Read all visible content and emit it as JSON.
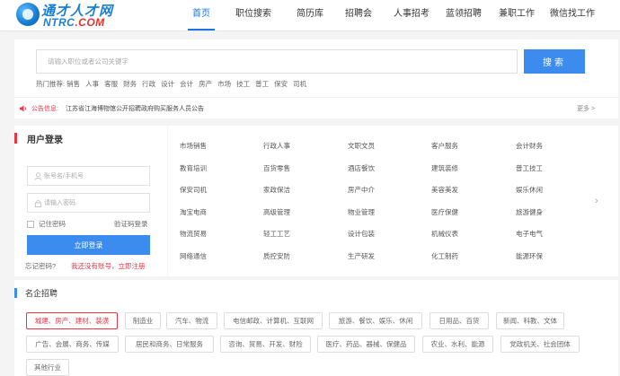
{
  "logo": {
    "cn": "通才人才网",
    "en_prefix": "NTRC",
    "en_suffix": ".COM"
  },
  "nav": [
    {
      "label": "首页",
      "active": true
    },
    {
      "label": "职位搜索"
    },
    {
      "label": "简历库"
    },
    {
      "label": "招聘会"
    },
    {
      "label": "人事招考"
    },
    {
      "label": "蓝领招聘"
    },
    {
      "label": "兼职工作"
    },
    {
      "label": "微信找工作"
    }
  ],
  "search": {
    "placeholder": "请输入职位或者公司关键字",
    "button": "搜索",
    "hot_label": "热门推荐:",
    "hot_keywords": [
      "销售",
      "人事",
      "客服",
      "财务",
      "行政",
      "设计",
      "会计",
      "房产",
      "市场",
      "技工",
      "普工",
      "保安",
      "司机"
    ]
  },
  "notice": {
    "label": "公告信息:",
    "text": "江苏省江海博物馆公开招聘政府购买服务人员公告",
    "more": "更多 >"
  },
  "login": {
    "title": "用户登录",
    "account_placeholder": "账号名/手机号",
    "password_placeholder": "请输入密码",
    "remember": "记住密码",
    "code_login": "验证码登录",
    "submit": "立即登录",
    "forgot": "忘记密码?",
    "register": "我还没有账号，立即注册"
  },
  "categories": [
    [
      "市场销售",
      "行政人事",
      "文职文员",
      "客户服务",
      "会计财务"
    ],
    [
      "教育培训",
      "百货零售",
      "酒店餐饮",
      "建筑装修",
      "普工技工"
    ],
    [
      "保安司机",
      "家政保洁",
      "房产中介",
      "美容美发",
      "娱乐休闲"
    ],
    [
      "淘宝电商",
      "高级管理",
      "物业管理",
      "医疗保健",
      "旅游健身"
    ],
    [
      "物流贸易",
      "轻工工艺",
      "设计包装",
      "机械仪表",
      "电子电气"
    ],
    [
      "网络通信",
      "质控安防",
      "生产研发",
      "化工制药",
      "能源环保"
    ]
  ],
  "famous": {
    "title": "名企招聘",
    "tags": [
      "城建、房产、建材、装潢",
      "制造业",
      "汽车、物流",
      "电信邮政、计算机、互联网",
      "旅游、餐饮、娱乐、休闲",
      "日用品、百货",
      "新闻、科教、文体",
      "广告、会展、商务、传媒",
      "居民和商务、日常服务",
      "咨询、贸易、开发、财险",
      "医疗、药品、器械、保健品",
      "农业、水利、能源",
      "党政机关、社会团体",
      "其他行业"
    ]
  },
  "colors": {
    "accent": "#3c8cf0",
    "nav_active": "#1a73e8",
    "red": "#e34"
  }
}
